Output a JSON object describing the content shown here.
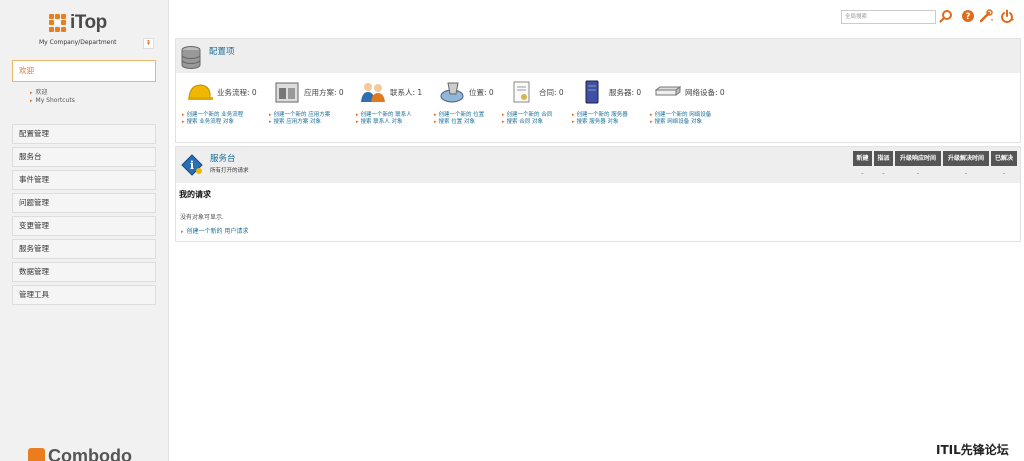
{
  "app": {
    "logo_text": "iTop",
    "organization": "My Company/Department",
    "vendor": "Combodo"
  },
  "search": {
    "placeholder": "全局搜索"
  },
  "sidebar": {
    "active_group": "欢迎",
    "active_items": [
      "欢迎",
      "My Shortcuts"
    ],
    "groups": [
      "配置管理",
      "服务台",
      "事件管理",
      "问题管理",
      "变更管理",
      "服务管理",
      "数据管理",
      "管理工具"
    ]
  },
  "config_panel": {
    "title": "配置项",
    "items": [
      {
        "label": "业务流程: 0",
        "icon": "helmet-icon",
        "create": "创建一个新的 业务流程",
        "search": "搜索 业务流程 对象"
      },
      {
        "label": "应用方案: 0",
        "icon": "application-icon",
        "create": "创建一个新的 应用方案",
        "search": "搜索 应用方案 对象"
      },
      {
        "label": "联系人: 1",
        "icon": "contacts-icon",
        "create": "创建一个新的 联系人",
        "search": "搜索 联系人 对象"
      },
      {
        "label": "位置: 0",
        "icon": "location-icon",
        "create": "创建一个新的 位置",
        "search": "搜索 位置 对象"
      },
      {
        "label": "合同: 0",
        "icon": "contract-icon",
        "create": "创建一个新的 合同",
        "search": "搜索 合同 对象"
      },
      {
        "label": "服务器: 0",
        "icon": "server-icon",
        "create": "创建一个新的 服务器",
        "search": "搜索 服务器 对象"
      },
      {
        "label": "网络设备: 0",
        "icon": "network-device-icon",
        "create": "创建一个新的 网络设备",
        "search": "搜索 网络设备 对象"
      }
    ]
  },
  "helpdesk_panel": {
    "title": "服务台",
    "subtitle": "所有打开的请求",
    "kpi_headers": [
      "新建",
      "指派",
      "升级响应时间",
      "升级解决时间",
      "已解决"
    ],
    "kpi_values": [
      "-",
      "-",
      "-",
      "-",
      "-"
    ],
    "section_title": "我的请求",
    "empty_message": "没有对象可显示.",
    "create_link": "创建一个新的 用户请求"
  },
  "watermark": "ITIL先锋论坛",
  "colors": {
    "accent": "#e06b1c",
    "link": "#1a6e9a",
    "header_dark": "#555555"
  }
}
